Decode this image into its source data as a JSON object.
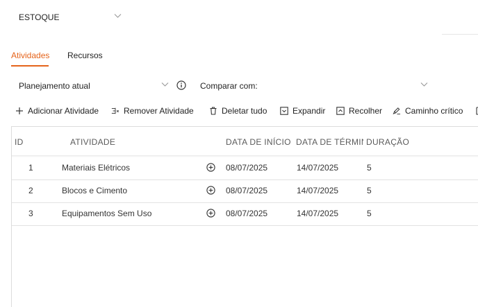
{
  "project": {
    "selected": "ESTOQUE"
  },
  "tabs": [
    {
      "label": "Atividades",
      "active": true
    },
    {
      "label": "Recursos",
      "active": false
    }
  ],
  "planning": {
    "current_label": "Planejamento atual",
    "compare_label": "Comparar com:"
  },
  "toolbar": {
    "add": "Adicionar Atividade",
    "remove": "Remover Atividade",
    "delete_all": "Deletar tudo",
    "expand": "Expandir",
    "collapse": "Recolher",
    "critical_path": "Caminho crítico"
  },
  "table": {
    "headers": {
      "id": "ID",
      "activity": "ATIVIDADE",
      "start": "DATA DE INÍCIO",
      "end": "DATA DE TÉRMIN",
      "duration": "DURAÇÃO"
    },
    "rows": [
      {
        "id": "1",
        "name": "Materiais Elétricos",
        "start": "08/07/2025",
        "end": "14/07/2025",
        "duration": "5"
      },
      {
        "id": "2",
        "name": "Blocos e Cimento",
        "start": "08/07/2025",
        "end": "14/07/2025",
        "duration": "5"
      },
      {
        "id": "3",
        "name": "Equipamentos Sem Uso",
        "start": "08/07/2025",
        "end": "14/07/2025",
        "duration": "5"
      }
    ]
  },
  "colors": {
    "accent": "#e5631a",
    "border": "#dcdcdc"
  }
}
